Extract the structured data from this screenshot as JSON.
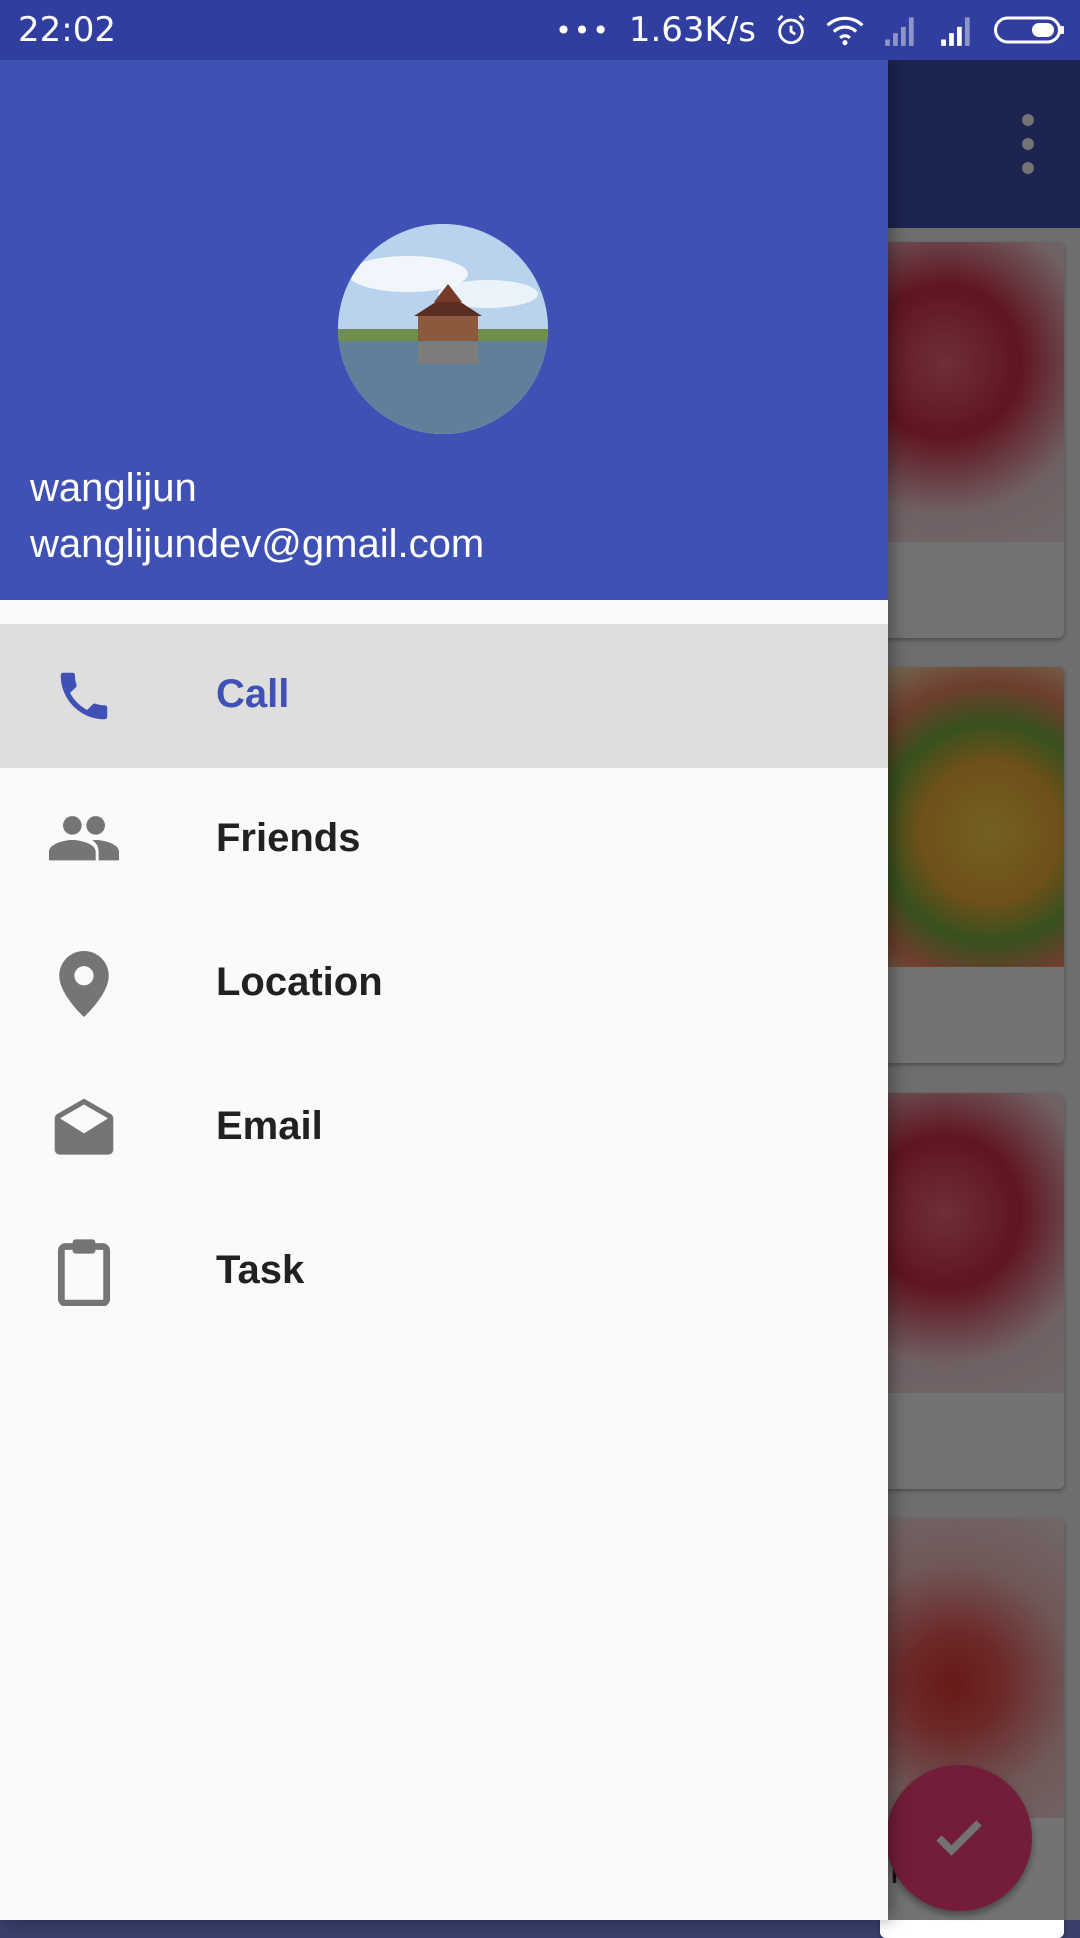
{
  "status_bar": {
    "time": "22:02",
    "dots": "•••",
    "speed": "1.63K/s",
    "icons": [
      "alarm-icon",
      "wifi-icon",
      "signal-icon",
      "signal-icon",
      "battery-icon"
    ]
  },
  "background_app": {
    "cards": [
      {
        "image": "cherries"
      },
      {
        "image": "mangoes"
      },
      {
        "image": "cherries"
      },
      {
        "image": "strawberry",
        "title": "rry"
      }
    ],
    "fab_icon": "check-icon"
  },
  "drawer": {
    "header": {
      "name": "wanglijun",
      "email": "wanglijundev@gmail.com",
      "avatar": "avatar"
    },
    "items": [
      {
        "label": "Call",
        "icon": "phone-icon",
        "active": true
      },
      {
        "label": "Friends",
        "icon": "people-icon",
        "active": false
      },
      {
        "label": "Location",
        "icon": "location-pin-icon",
        "active": false
      },
      {
        "label": "Email",
        "icon": "email-icon",
        "active": false
      },
      {
        "label": "Task",
        "icon": "clipboard-icon",
        "active": false
      }
    ]
  },
  "colors": {
    "primary": "#3f51b5",
    "primary_dark": "#303f9f",
    "accent": "#ff4081",
    "active_item_bg": "#dedede"
  }
}
